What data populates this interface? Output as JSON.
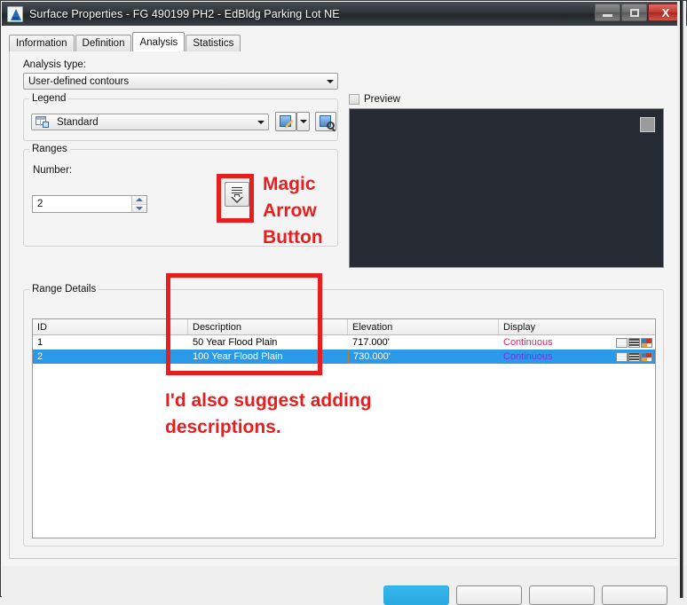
{
  "window": {
    "title": "Surface Properties - FG 490199 PH2 - EdBldg Parking Lot NE",
    "icon": "autocad-logo-icon",
    "minimize": "",
    "maximize": "",
    "close": "X"
  },
  "tabs": [
    {
      "label": "Information",
      "active": false
    },
    {
      "label": "Definition",
      "active": false
    },
    {
      "label": "Analysis",
      "active": true
    },
    {
      "label": "Statistics",
      "active": false
    }
  ],
  "analysis": {
    "type_label": "Analysis type:",
    "type_value": "User-defined contours"
  },
  "legend": {
    "group_title": "Legend",
    "value": "Standard",
    "edit_icon": "edit-page-icon",
    "dropdown_icon": "chevron-down-icon",
    "preview_icon": "page-magnifier-icon"
  },
  "ranges": {
    "group_title": "Ranges",
    "number_label": "Number:",
    "number_value": "2",
    "run_icon": "fill-down-arrow-icon"
  },
  "preview": {
    "checkbox_label": "Preview",
    "checked": false
  },
  "range_details": {
    "group_title": "Range Details",
    "columns": [
      "ID",
      "Description",
      "Elevation",
      "Display"
    ],
    "rows": [
      {
        "id": "1",
        "description": "50 Year Flood Plain",
        "elevation": "717.000'",
        "display": "Continuous",
        "display_color": "#e0246c",
        "selected": false
      },
      {
        "id": "2",
        "description": "100 Year Flood Plain",
        "elevation": "730.000'",
        "display": "Continuous",
        "display_color": "#8a2be2",
        "selected": true
      }
    ]
  },
  "annotations": {
    "magic_line1": "Magic",
    "magic_line2": "Arrow",
    "magic_line3": "Button",
    "desc_line1": "I'd also suggest adding",
    "desc_line2": "descriptions.",
    "color": "#e81e1e"
  },
  "footer": {
    "ok": "",
    "cancel": "",
    "apply": "",
    "help": ""
  }
}
